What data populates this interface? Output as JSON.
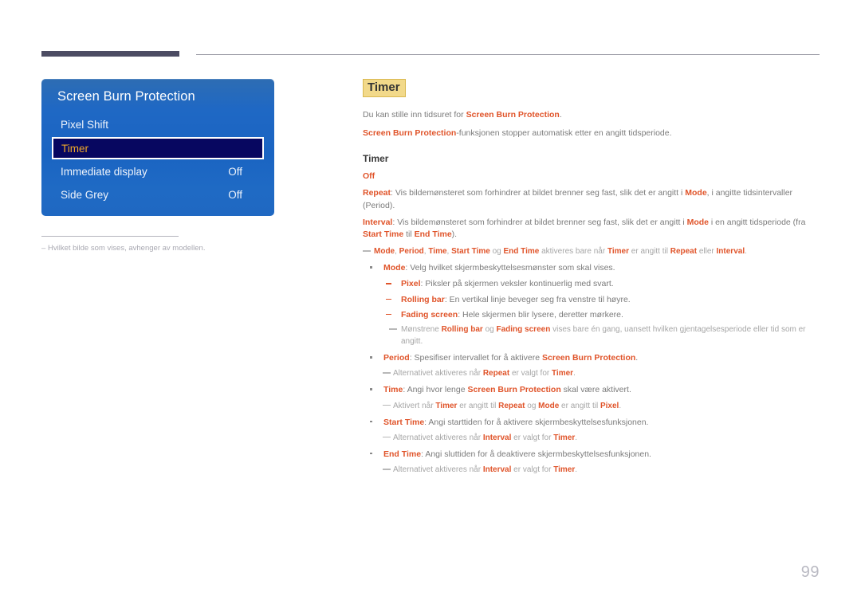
{
  "page": {
    "number": "99"
  },
  "osd": {
    "title": "Screen Burn Protection",
    "rows": [
      {
        "label": "Pixel Shift",
        "value": ""
      },
      {
        "label": "Timer",
        "value": ""
      },
      {
        "label": "Immediate display",
        "value": "Off"
      },
      {
        "label": "Side Grey",
        "value": "Off"
      }
    ],
    "selected_index": 1,
    "footnote": {
      "dash": "–",
      "text": "Hvilket bilde som vises, avhenger av modellen."
    }
  },
  "content": {
    "heading": "Timer",
    "intro": [
      {
        "before": "Du kan stille inn tidsuret for ",
        "key": "Screen Burn Protection",
        "after": "."
      },
      {
        "before": "",
        "key": "Screen Burn Protection",
        "after": "-funksjonen stopper automatisk etter en angitt tidsperiode."
      }
    ],
    "sub_heading": "Timer",
    "options": {
      "off": "Off",
      "repeat_key": "Repeat",
      "repeat_text_1": ": Vis bildemønsteret som forhindrer at bildet brenner seg fast, slik det er angitt i ",
      "repeat_mode": "Mode",
      "repeat_text_2": ", i angitte tidsintervaller (Period).",
      "interval_key": "Interval",
      "interval_text_1": ": Vis bildemønsteret som forhindrer at bildet brenner seg fast, slik det er angitt i ",
      "interval_mode": "Mode",
      "interval_text_2": " i en angitt tidsperiode (fra ",
      "interval_start": "Start Time",
      "interval_text_3": " til ",
      "interval_end": "End Time",
      "interval_text_4": ")."
    },
    "note_top": {
      "k1": "Mode",
      "sep1": ", ",
      "k2": "Period",
      "sep2": ", ",
      "k3": "Time",
      "sep3": ", ",
      "k4": "Start Time",
      "sep4": " og ",
      "k5": "End Time",
      "mid": " aktiveres bare når ",
      "k6": "Timer",
      "mid2": " er angitt til ",
      "k7": "Repeat",
      "mid3": " eller ",
      "k8": "Interval",
      "end": "."
    },
    "mode": {
      "key": "Mode",
      "text": ": Velg hvilket skjermbeskyttelsesmønster som skal vises.",
      "subitems": [
        {
          "key": "Pixel",
          "text": ": Piksler på skjermen veksler kontinuerlig med svart."
        },
        {
          "key": "Rolling bar",
          "text": ": En vertikal linje beveger seg fra venstre til høyre."
        },
        {
          "key": "Fading screen",
          "text": ": Hele skjermen blir lysere, deretter mørkere."
        }
      ],
      "note": {
        "before": "Mønstrene ",
        "k1": "Rolling bar",
        "mid": " og ",
        "k2": "Fading screen",
        "after": " vises bare én gang, uansett hvilken gjentagelsesperiode eller tid som er angitt."
      }
    },
    "period": {
      "key": "Period",
      "text_1": ": Spesifiser intervallet for å aktivere ",
      "key_2": "Screen Burn Protection",
      "text_2": ".",
      "note": {
        "before": "Alternativet aktiveres når ",
        "k1": "Repeat",
        "mid": " er valgt for ",
        "k2": "Timer",
        "after": "."
      }
    },
    "time": {
      "key": "Time",
      "text_1": ": Angi hvor lenge ",
      "key_2": "Screen Burn Protection",
      "text_2": " skal være aktivert.",
      "note": {
        "before": "Aktivert når ",
        "k1": "Timer",
        "mid": " er angitt til ",
        "k2": "Repeat",
        "mid2": " og ",
        "k3": "Mode",
        "mid3": " er angitt til ",
        "k4": "Pixel",
        "after": "."
      }
    },
    "start_time": {
      "key": "Start Time",
      "text": ": Angi starttiden for å aktivere skjermbeskyttelsesfunksjonen.",
      "note": {
        "before": "Alternativet aktiveres når ",
        "k1": "Interval",
        "mid": " er valgt for ",
        "k2": "Timer",
        "after": "."
      }
    },
    "end_time": {
      "key": "End Time",
      "text": ": Angi sluttiden for å deaktivere skjermbeskyttelsesfunksjonen.",
      "note": {
        "before": "Alternativet aktiveres når ",
        "k1": "Interval",
        "mid": " er valgt for ",
        "k2": "Timer",
        "after": "."
      }
    }
  },
  "colors": {
    "accent_orange": "#e0542a",
    "panel_blue": "#1f68c4",
    "selected_navy": "#070760",
    "selected_text": "#f0a829",
    "highlight_yellow": "#f2d98a",
    "rule_dark": "#4c4c63"
  }
}
